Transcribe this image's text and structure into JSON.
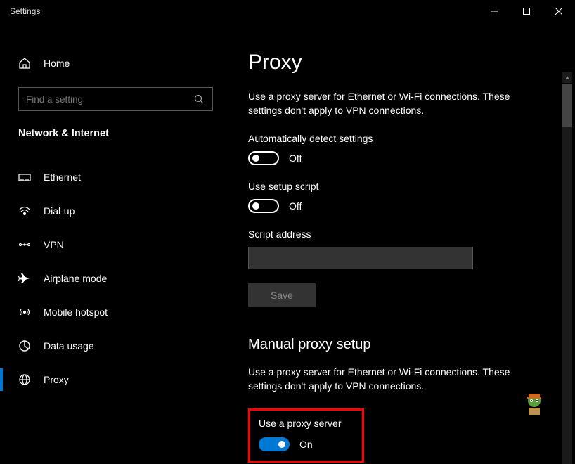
{
  "window": {
    "title": "Settings"
  },
  "sidebar": {
    "home": "Home",
    "search_placeholder": "Find a setting",
    "section": "Network & Internet",
    "items": [
      {
        "label": "Ethernet"
      },
      {
        "label": "Dial-up"
      },
      {
        "label": "VPN"
      },
      {
        "label": "Airplane mode"
      },
      {
        "label": "Mobile hotspot"
      },
      {
        "label": "Data usage"
      },
      {
        "label": "Proxy"
      }
    ]
  },
  "main": {
    "title": "Proxy",
    "desc1": "Use a proxy server for Ethernet or Wi-Fi connections. These settings don't apply to VPN connections.",
    "auto_detect_label": "Automatically detect settings",
    "auto_detect_state": "Off",
    "setup_script_label": "Use setup script",
    "setup_script_state": "Off",
    "script_address_label": "Script address",
    "script_address_value": "",
    "save_label": "Save",
    "manual_heading": "Manual proxy setup",
    "desc2": "Use a proxy server for Ethernet or Wi-Fi connections. These settings don't apply to VPN connections.",
    "use_proxy_label": "Use a proxy server",
    "use_proxy_state": "On"
  }
}
